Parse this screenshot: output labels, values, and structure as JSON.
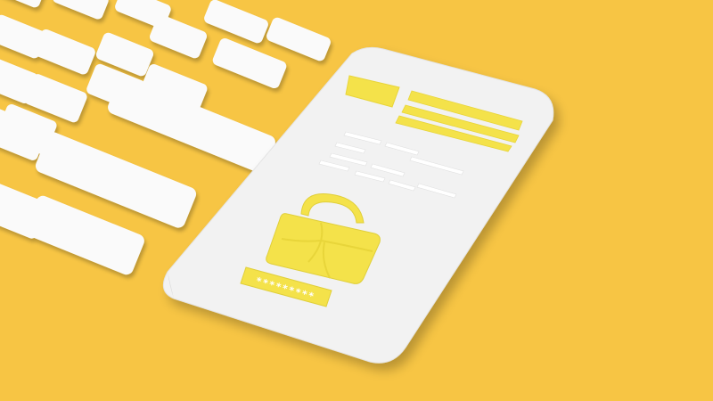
{
  "scene": {
    "background_color": "#f7c544",
    "keyboard_key_color": "#fafafa",
    "phone_color": "#f2f2f2",
    "accent_color": "#f4e24a",
    "password_mask": "*********",
    "icons": [
      "keyboard",
      "smartphone",
      "padlock",
      "text-lines",
      "image-placeholder"
    ]
  }
}
